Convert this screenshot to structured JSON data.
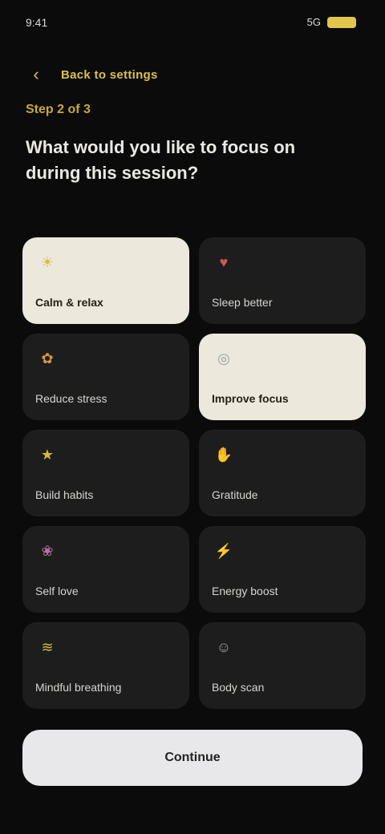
{
  "status": {
    "time": "9:41",
    "signal": "5G"
  },
  "header": {
    "back_label": "Back to settings",
    "step": "Step 2 of 3",
    "title": "What would you like to focus on during this session?"
  },
  "options": [
    {
      "label": "Calm & relax",
      "icon": "sun-icon",
      "glyph": "☀",
      "color": "yellow",
      "selected": true
    },
    {
      "label": "Sleep better",
      "icon": "heart-icon",
      "glyph": "♥",
      "color": "red",
      "selected": false
    },
    {
      "label": "Reduce stress",
      "icon": "leaf-icon",
      "glyph": "✿",
      "color": "orange",
      "selected": false
    },
    {
      "label": "Improve focus",
      "icon": "target-icon",
      "glyph": "◎",
      "color": "gray",
      "selected": true
    },
    {
      "label": "Build habits",
      "icon": "star-icon",
      "glyph": "★",
      "color": "yellow",
      "selected": false
    },
    {
      "label": "Gratitude",
      "icon": "hand-icon",
      "glyph": "✋",
      "color": "gray",
      "selected": false
    },
    {
      "label": "Self love",
      "icon": "flower-icon",
      "glyph": "❀",
      "color": "pink",
      "selected": false
    },
    {
      "label": "Energy boost",
      "icon": "bolt-icon",
      "glyph": "⚡",
      "color": "orange",
      "selected": false
    },
    {
      "label": "Mindful breathing",
      "icon": "wind-icon",
      "glyph": "≋",
      "color": "yellow",
      "selected": false
    },
    {
      "label": "Body scan",
      "icon": "person-icon",
      "glyph": "☺",
      "color": "gray",
      "selected": false
    }
  ],
  "footer": {
    "continue_label": "Continue"
  }
}
